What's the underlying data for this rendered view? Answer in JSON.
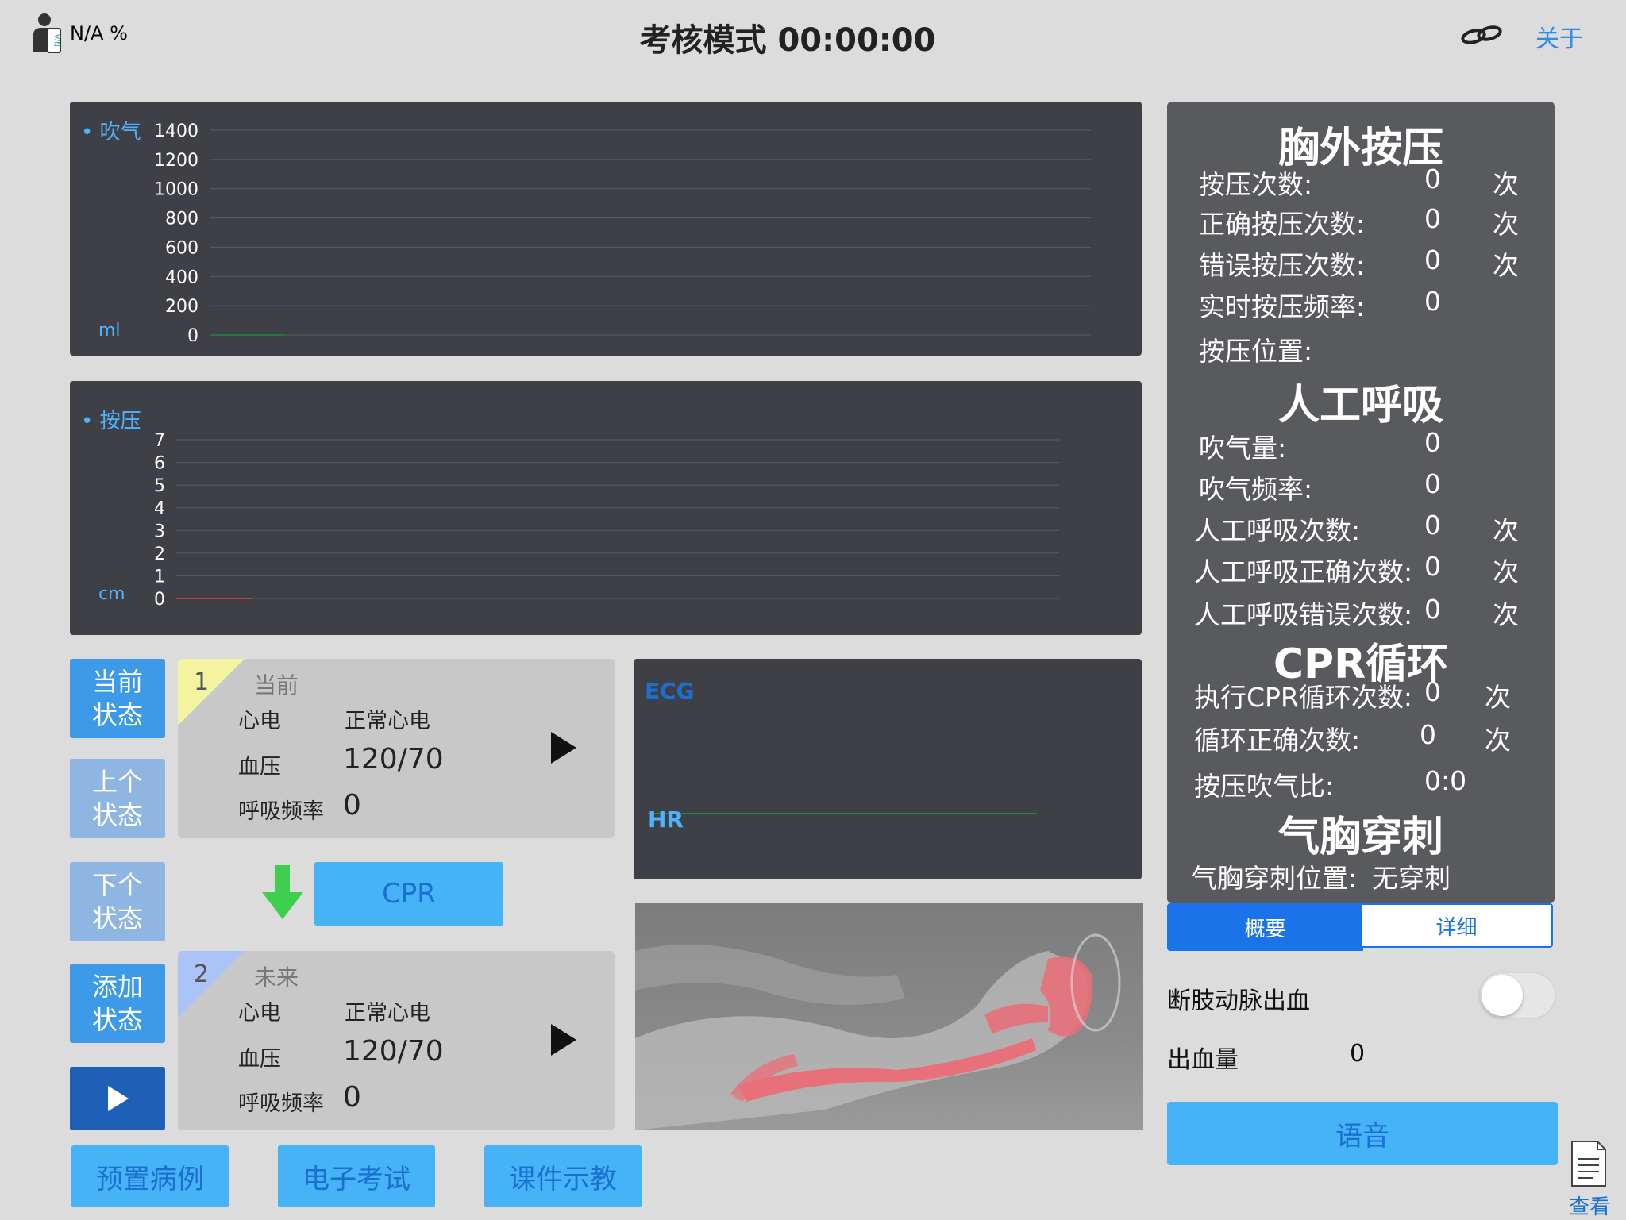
{
  "topbar": {
    "battery_text": "N/A %",
    "title": "考核模式  00:00:00",
    "about": "关于"
  },
  "breath_chart": {
    "legend": "吹气",
    "unit": "ml",
    "yticks": [
      "1400",
      "1200",
      "1000",
      "800",
      "600",
      "400",
      "200",
      "0"
    ]
  },
  "press_chart": {
    "legend": "按压",
    "unit": "cm",
    "yticks": [
      "7",
      "6",
      "5",
      "4",
      "3",
      "2",
      "1",
      "0"
    ]
  },
  "chart_data": [
    {
      "type": "line",
      "legend": "吹气",
      "ylabel": "ml",
      "ylim": [
        0,
        1400
      ],
      "yticks": [
        0,
        200,
        400,
        600,
        800,
        1000,
        1200,
        1400
      ],
      "series": [
        {
          "name": "吹气",
          "values": [
            0,
            0
          ],
          "color": "#1e7a3c"
        }
      ]
    },
    {
      "type": "line",
      "legend": "按压",
      "ylabel": "cm",
      "ylim": [
        0,
        7
      ],
      "yticks": [
        0,
        1,
        2,
        3,
        4,
        5,
        6,
        7
      ],
      "series": [
        {
          "name": "按压",
          "values": [
            0,
            0
          ],
          "color": "#c04040"
        }
      ]
    }
  ],
  "state_buttons": {
    "current": [
      "当前",
      "状态"
    ],
    "prev": [
      "上个",
      "状态"
    ],
    "next": [
      "下个",
      "状态"
    ],
    "add": [
      "添加",
      "状态"
    ]
  },
  "cards": [
    {
      "num": "1",
      "tag": "当前",
      "ecg_label": "心电",
      "ecg_value": "正常心电",
      "bp_label": "血压",
      "bp_value": "120/70",
      "resp_label": "呼吸频率",
      "resp_value": "0",
      "corner_color": "#f3f3a0"
    },
    {
      "num": "2",
      "tag": "未来",
      "ecg_label": "心电",
      "ecg_value": "正常心电",
      "bp_label": "血压",
      "bp_value": "120/70",
      "resp_label": "呼吸频率",
      "resp_value": "0",
      "corner_color": "#a9c4f5"
    }
  ],
  "cpr_button": "CPR",
  "ecg": {
    "ecg_label": "ECG",
    "hr_label": "HR"
  },
  "bottom_buttons": [
    "预置病例",
    "电子考试",
    "课件示教"
  ],
  "stats": {
    "chest_title": "胸外按压",
    "chest_rows": [
      {
        "label": "按压次数:",
        "value": "0",
        "unit": "次"
      },
      {
        "label": "正确按压次数:",
        "value": "0",
        "unit": "次"
      },
      {
        "label": "错误按压次数:",
        "value": "0",
        "unit": "次"
      },
      {
        "label": "实时按压频率:",
        "value": "0",
        "unit": ""
      },
      {
        "label": "按压位置:",
        "value": "",
        "unit": ""
      }
    ],
    "resp_title": "人工呼吸",
    "resp_rows": [
      {
        "label": "吹气量:",
        "value": "0",
        "unit": ""
      },
      {
        "label": "吹气频率:",
        "value": "0",
        "unit": ""
      },
      {
        "label": "人工呼吸次数:",
        "value": "0",
        "unit": "次"
      },
      {
        "label": "人工呼吸正确次数:",
        "value": "0",
        "unit": "次"
      },
      {
        "label": "人工呼吸错误次数:",
        "value": "0",
        "unit": "次"
      }
    ],
    "cpr_title": "CPR循环",
    "cpr_rows": [
      {
        "label": "执行CPR循环次数:",
        "value": "0",
        "unit": "次"
      },
      {
        "label": "循环正确次数:",
        "value": "0",
        "unit": "次"
      },
      {
        "label": "按压吹气比:",
        "value": "0:0",
        "unit": ""
      }
    ],
    "pneumo_title": "气胸穿刺",
    "pneumo_row": {
      "label": "气胸穿刺位置:",
      "value": "无穿刺"
    }
  },
  "tabs": {
    "summary": "概要",
    "detail": "详细"
  },
  "bleeding": {
    "label": "断肢动脉出血",
    "amount_label": "出血量",
    "amount_value": "0",
    "toggle_on": false
  },
  "voice_button": "语音",
  "view_button": "查看"
}
